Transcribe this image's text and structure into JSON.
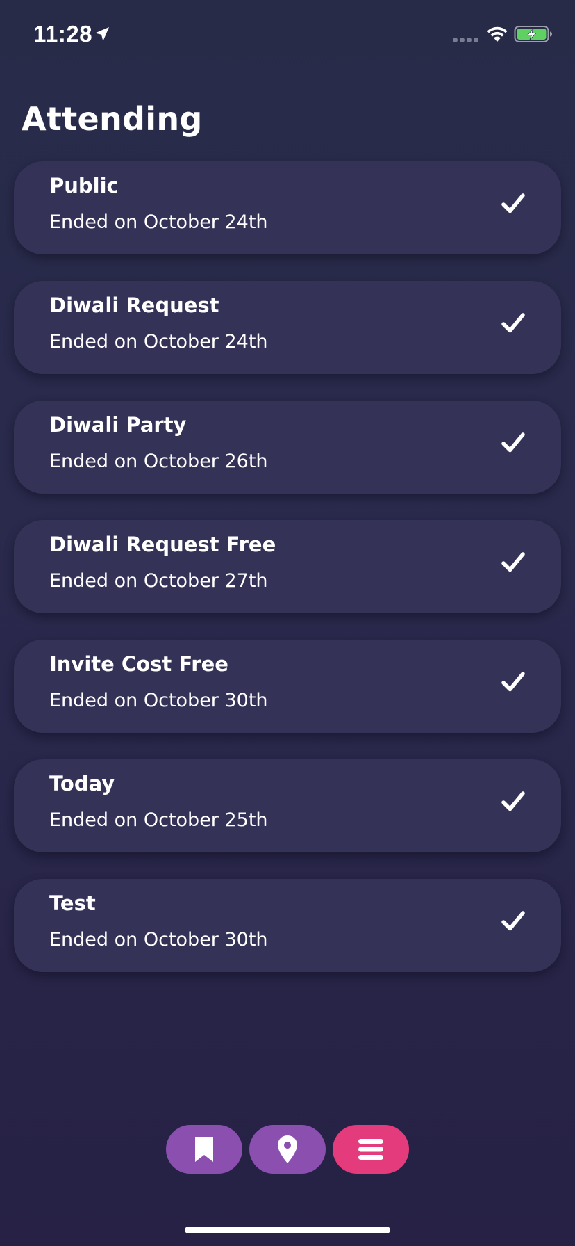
{
  "status_bar": {
    "time": "11:28",
    "icons": [
      "location-arrow-icon",
      "signal-dots-icon",
      "wifi-icon",
      "battery-charging-icon"
    ],
    "battery_color": "#5ed162"
  },
  "page": {
    "title": "Attending"
  },
  "events": [
    {
      "title": "Public",
      "subtitle": "Ended on October 24th",
      "icon": "checkmark-icon"
    },
    {
      "title": "Diwali Request",
      "subtitle": "Ended on October 24th",
      "icon": "checkmark-icon"
    },
    {
      "title": "Diwali Party",
      "subtitle": "Ended on October 26th",
      "icon": "checkmark-icon"
    },
    {
      "title": "Diwali Request Free",
      "subtitle": "Ended on October 27th",
      "icon": "checkmark-icon"
    },
    {
      "title": "Invite Cost Free",
      "subtitle": "Ended on October 30th",
      "icon": "checkmark-icon"
    },
    {
      "title": "Today",
      "subtitle": "Ended on October 25th",
      "icon": "checkmark-icon"
    },
    {
      "title": "Test",
      "subtitle": "Ended on October 30th",
      "icon": "checkmark-icon"
    }
  ],
  "bottom_nav": {
    "items": [
      {
        "icon": "bookmark-icon",
        "color": "#8b4fb0"
      },
      {
        "icon": "map-pin-icon",
        "color": "#8b4fb0"
      },
      {
        "icon": "menu-icon",
        "color": "#e33b7b",
        "active": true
      }
    ]
  },
  "colors": {
    "background_top": "#272b48",
    "background_bottom": "#262145",
    "card": "#343257"
  }
}
